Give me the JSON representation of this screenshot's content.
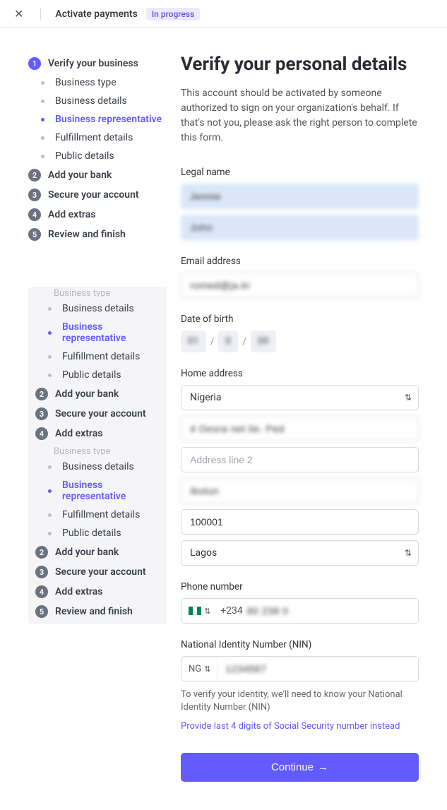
{
  "header": {
    "title": "Activate payments",
    "status": "In progress"
  },
  "sidebar": {
    "steps": [
      {
        "num": 1,
        "label": "Verify your business",
        "active": true
      },
      {
        "num": 2,
        "label": "Add your bank"
      },
      {
        "num": 3,
        "label": "Secure your account"
      },
      {
        "num": 4,
        "label": "Add extras"
      },
      {
        "num": 5,
        "label": "Review and finish"
      }
    ],
    "substeps": [
      {
        "label": "Business type"
      },
      {
        "label": "Business details"
      },
      {
        "label": "Business representative",
        "current": true
      },
      {
        "label": "Fulfillment details"
      },
      {
        "label": "Public details"
      }
    ]
  },
  "form": {
    "title": "Verify your personal details",
    "desc": "This account should be activated by someone authorized to sign on your organization's behalf. If that's not you, please ask the right person to complete this form.",
    "labels": {
      "legal_name": "Legal name",
      "email": "Email address",
      "dob": "Date of birth",
      "home_address": "Home address",
      "phone": "Phone number",
      "nin": "National Identity Number (NIN)"
    },
    "legal_name": {
      "first": "Jennie",
      "last": "John"
    },
    "email": "romed@ja.kr",
    "dob": {
      "m": "01",
      "d": "0",
      "y": "00"
    },
    "address": {
      "country": "Nigeria",
      "line1": "4 Oesra net lie. Ped",
      "line2_placeholder": "Address line 2",
      "city": "Ikotun",
      "postal": "100001",
      "state": "Lagos"
    },
    "phone": {
      "code": "+234",
      "number": "80 238 0"
    },
    "nin": {
      "prefix": "NG",
      "value": "1234567"
    },
    "nin_helper": "To verify your identity, we'll need to know your National Identity Number (NIN)",
    "ssn_link": "Provide last 4 digits of Social Security number instead",
    "continue": "Continue"
  }
}
